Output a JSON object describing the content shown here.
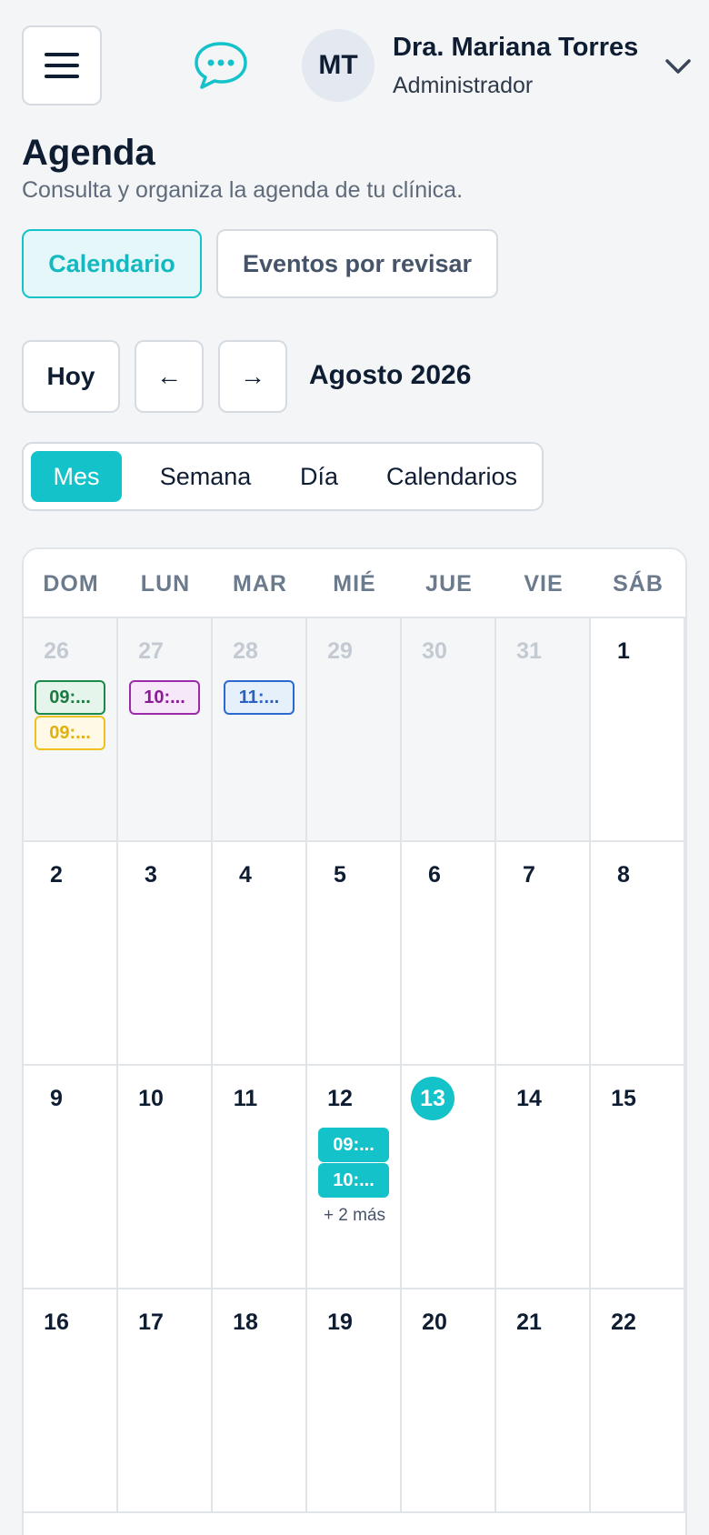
{
  "header": {
    "user_initials": "MT",
    "user_name": "Dra. Mariana Torres",
    "user_role": "Administrador"
  },
  "page": {
    "title": "Agenda",
    "subtitle": "Consulta y organiza la agenda de tu clínica."
  },
  "tabs": {
    "calendar": "Calendario",
    "review": "Eventos por revisar",
    "active": "calendar"
  },
  "navigation": {
    "today": "Hoy",
    "prev": "←",
    "next": "→",
    "month_label": "Agosto 2026"
  },
  "views": {
    "month": "Mes",
    "week": "Semana",
    "day": "Día",
    "calendars": "Calendarios",
    "active": "month"
  },
  "calendar": {
    "weekdays": [
      "DOM",
      "LUN",
      "MAR",
      "MIÉ",
      "JUE",
      "VIE",
      "SÁB"
    ],
    "weeks": [
      [
        {
          "day": "26",
          "other": true,
          "events": [
            {
              "label": "09:...",
              "color": "green"
            },
            {
              "label": "09:...",
              "color": "yellow"
            }
          ]
        },
        {
          "day": "27",
          "other": true,
          "events": [
            {
              "label": "10:...",
              "color": "purple"
            }
          ]
        },
        {
          "day": "28",
          "other": true,
          "events": [
            {
              "label": "11:...",
              "color": "blue"
            }
          ]
        },
        {
          "day": "29",
          "other": true,
          "events": []
        },
        {
          "day": "30",
          "other": true,
          "events": []
        },
        {
          "day": "31",
          "other": true,
          "events": []
        },
        {
          "day": "1",
          "other": false,
          "events": []
        }
      ],
      [
        {
          "day": "2",
          "other": false,
          "events": []
        },
        {
          "day": "3",
          "other": false,
          "events": []
        },
        {
          "day": "4",
          "other": false,
          "events": []
        },
        {
          "day": "5",
          "other": false,
          "events": []
        },
        {
          "day": "6",
          "other": false,
          "events": []
        },
        {
          "day": "7",
          "other": false,
          "events": []
        },
        {
          "day": "8",
          "other": false,
          "events": []
        }
      ],
      [
        {
          "day": "9",
          "other": false,
          "events": []
        },
        {
          "day": "10",
          "other": false,
          "events": []
        },
        {
          "day": "11",
          "other": false,
          "events": []
        },
        {
          "day": "12",
          "other": false,
          "events": [
            {
              "label": "09:...",
              "color": "teal"
            },
            {
              "label": "10:...",
              "color": "teal"
            }
          ],
          "more": "+ 2 más"
        },
        {
          "day": "13",
          "other": false,
          "today": true,
          "events": []
        },
        {
          "day": "14",
          "other": false,
          "events": []
        },
        {
          "day": "15",
          "other": false,
          "events": []
        }
      ],
      [
        {
          "day": "16",
          "other": false,
          "events": []
        },
        {
          "day": "17",
          "other": false,
          "events": []
        },
        {
          "day": "18",
          "other": false,
          "events": []
        },
        {
          "day": "19",
          "other": false,
          "events": []
        },
        {
          "day": "20",
          "other": false,
          "events": []
        },
        {
          "day": "21",
          "other": false,
          "events": []
        },
        {
          "day": "22",
          "other": false,
          "events": []
        }
      ]
    ]
  },
  "colors": {
    "accent": "#14c2c9",
    "text_dark": "#0f1d33",
    "event_green": "#1a8a4a",
    "event_yellow": "#f0c020",
    "event_purple": "#9a2aa8",
    "event_blue": "#2a6ad0"
  }
}
